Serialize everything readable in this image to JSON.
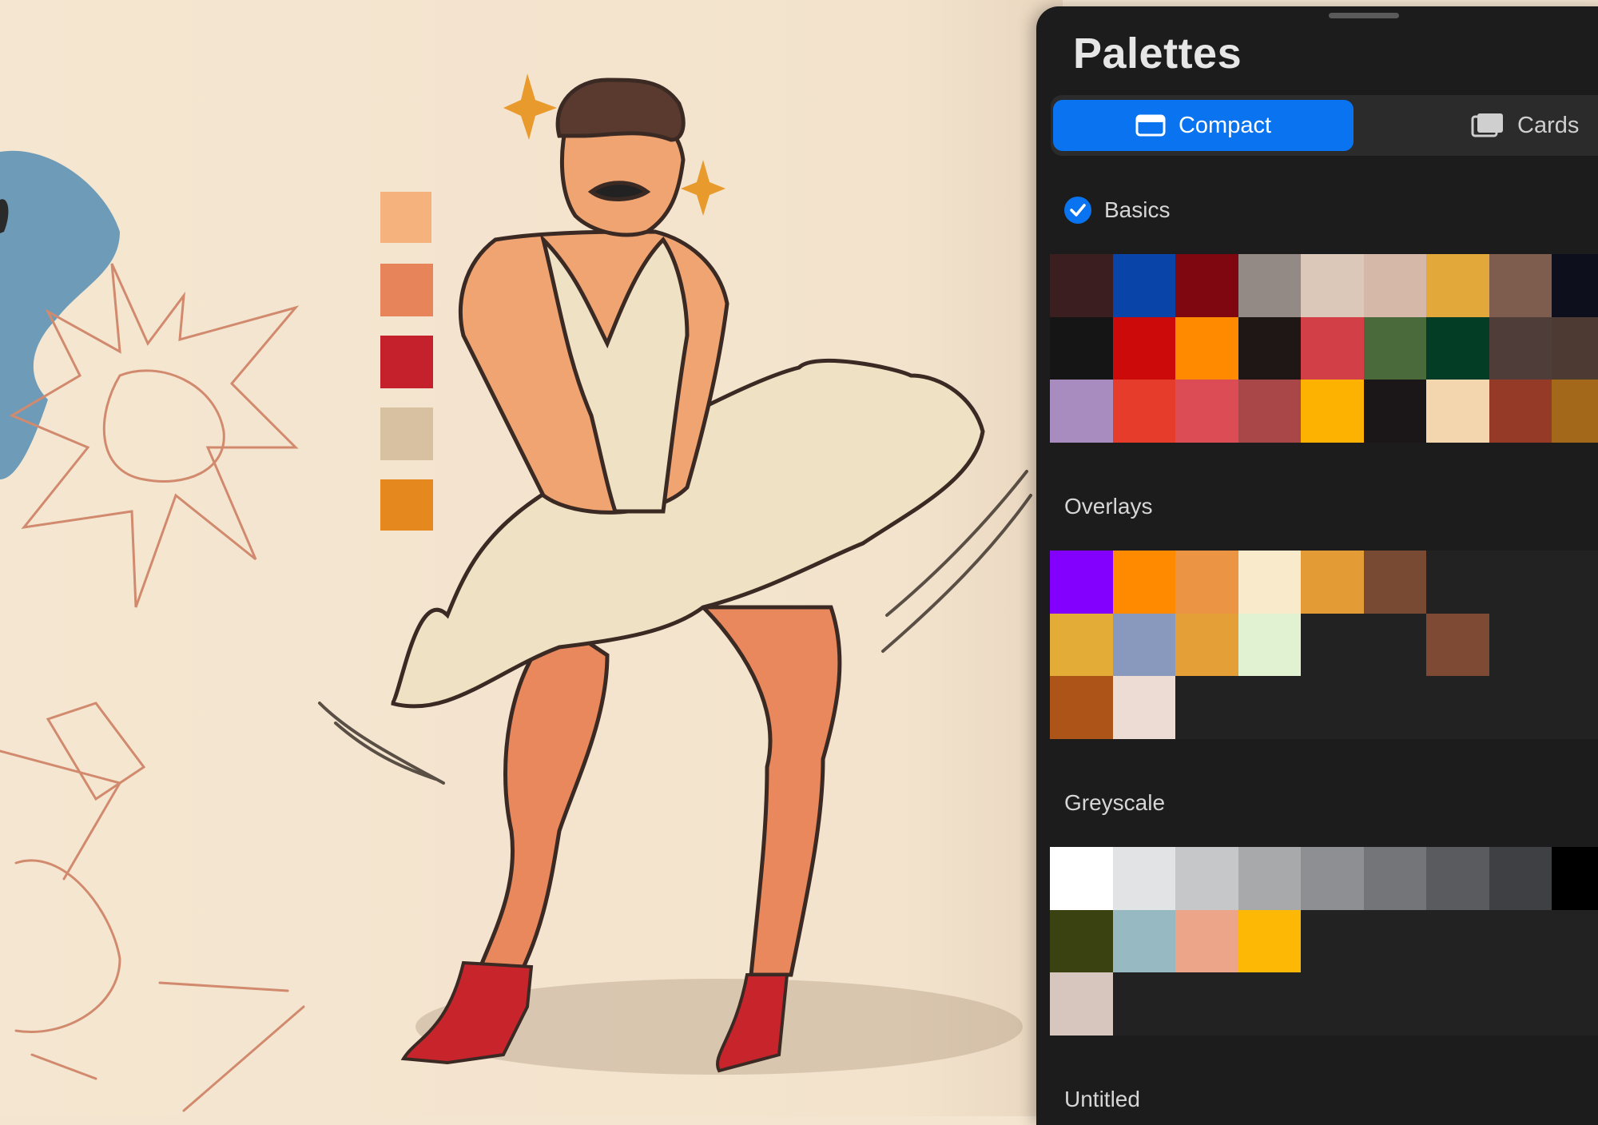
{
  "panel": {
    "title": "Palettes",
    "view_toggle": {
      "compact_label": "Compact",
      "cards_label": "Cards",
      "selected": "Compact"
    },
    "palettes": [
      {
        "name": "Basics",
        "is_default": true,
        "rows": [
          [
            "#3a1e20",
            "#0944a8",
            "#7e0710",
            "#948a85",
            "#dcc8b8",
            "#d5b8a8",
            "#e2a83a",
            "#7e5c4e",
            "#0d0f1d"
          ],
          [
            "#151515",
            "#cc0a0a",
            "#ff8a00",
            "#1f1716",
            "#d23f46",
            "#4a6a3c",
            "#033d26",
            "#4f3d39",
            "#4d3a32"
          ],
          [
            "#a88cc0",
            "#e63c2c",
            "#dc4c55",
            "#a84648",
            "#fdb100",
            "#1b1617",
            "#f3d6ad",
            "#943a26",
            "#a4681a"
          ]
        ]
      },
      {
        "name": "Overlays",
        "is_default": false,
        "rows": [
          [
            "#8300ff",
            "#ff8a00",
            "#ea9444",
            "#f9eacc",
            "#e39b35",
            "#794a33",
            null,
            null,
            null
          ],
          [
            "#e3ac36",
            "#8899bd",
            "#e49f36",
            "#e1f2d2",
            null,
            null,
            "#7e4a33",
            null,
            null
          ],
          [
            "#ad5418",
            "#ecdcd3",
            null,
            null,
            null,
            null,
            null,
            null,
            null
          ]
        ]
      },
      {
        "name": "Greyscale",
        "is_default": false,
        "rows": [
          [
            "#ffffff",
            "#e1e3e4",
            "#c6c7c9",
            "#a7a9ab",
            "#8d8f92",
            "#737578",
            "#595b5e",
            "#3f4043",
            "#000000"
          ],
          [
            "#3a4212",
            "#96b9c2",
            "#eca588",
            "#fdb705",
            null,
            null,
            null,
            null,
            null
          ],
          [
            "#d7c6bd",
            null,
            null,
            null,
            null,
            null,
            null,
            null,
            null
          ]
        ]
      },
      {
        "name": "Untitled",
        "is_default": false,
        "rows": []
      }
    ]
  },
  "canvas": {
    "reference_swatches": [
      "#f6b27c",
      "#e8845a",
      "#c4212c",
      "#d7c1a0",
      "#e5891f"
    ]
  }
}
